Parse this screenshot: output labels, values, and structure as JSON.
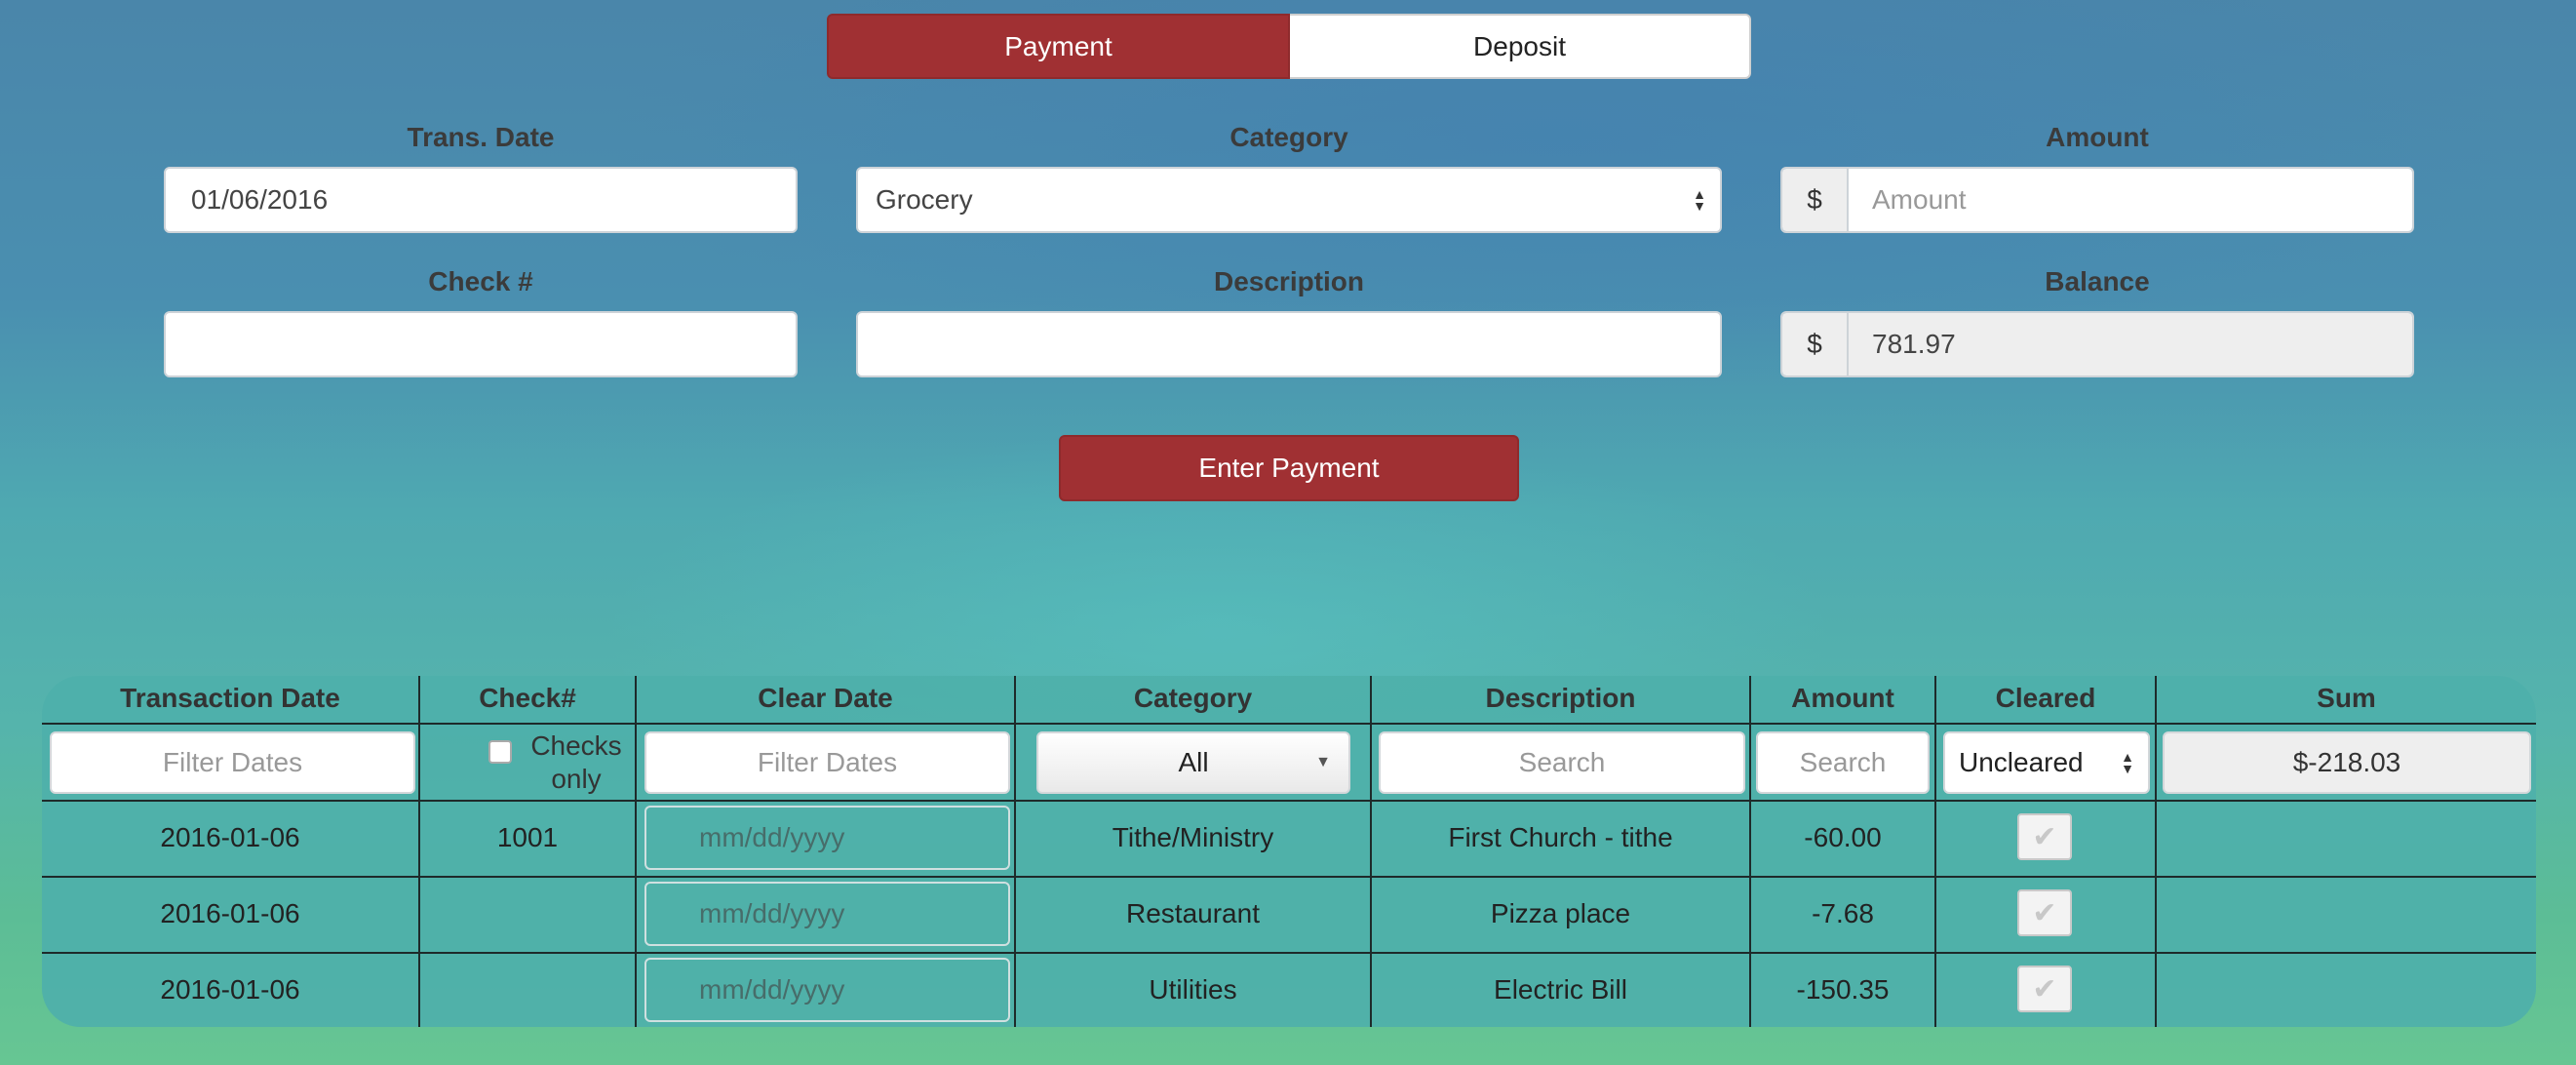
{
  "toggle": {
    "payment": "Payment",
    "deposit": "Deposit"
  },
  "form": {
    "trans_date_label": "Trans. Date",
    "trans_date_value": "01/06/2016",
    "category_label": "Category",
    "category_value": "Grocery",
    "amount_label": "Amount",
    "amount_prefix": "$",
    "amount_placeholder": "Amount",
    "check_label": "Check #",
    "description_label": "Description",
    "balance_label": "Balance",
    "balance_prefix": "$",
    "balance_value": "781.97",
    "submit": "Enter Payment"
  },
  "table": {
    "headers": [
      "Transaction Date",
      "Check#",
      "Clear Date",
      "Category",
      "Description",
      "Amount",
      "Cleared",
      "Sum"
    ],
    "filters": {
      "date_placeholder": "Filter Dates",
      "checks_only": "Checks only",
      "clear_date_placeholder": "Filter Dates",
      "category": "All",
      "description_placeholder": "Search",
      "amount_placeholder": "Search",
      "cleared": "Uncleared",
      "sum": "$-218.03"
    },
    "rows": [
      {
        "date": "2016-01-06",
        "check": "1001",
        "clear_date": "mm/dd/yyyy",
        "category": "Tithe/Ministry",
        "description": "First Church - tithe",
        "amount": "-60.00"
      },
      {
        "date": "2016-01-06",
        "check": "",
        "clear_date": "mm/dd/yyyy",
        "category": "Restaurant",
        "description": "Pizza place",
        "amount": "-7.68"
      },
      {
        "date": "2016-01-06",
        "check": "",
        "clear_date": "mm/dd/yyyy",
        "category": "Utilities",
        "description": "Electric Bill",
        "amount": "-150.35"
      }
    ]
  },
  "icons": {
    "checkmark": "check-icon",
    "select-arrows": "up-down-caret-icon",
    "dropdown": "chevron-down-icon"
  }
}
